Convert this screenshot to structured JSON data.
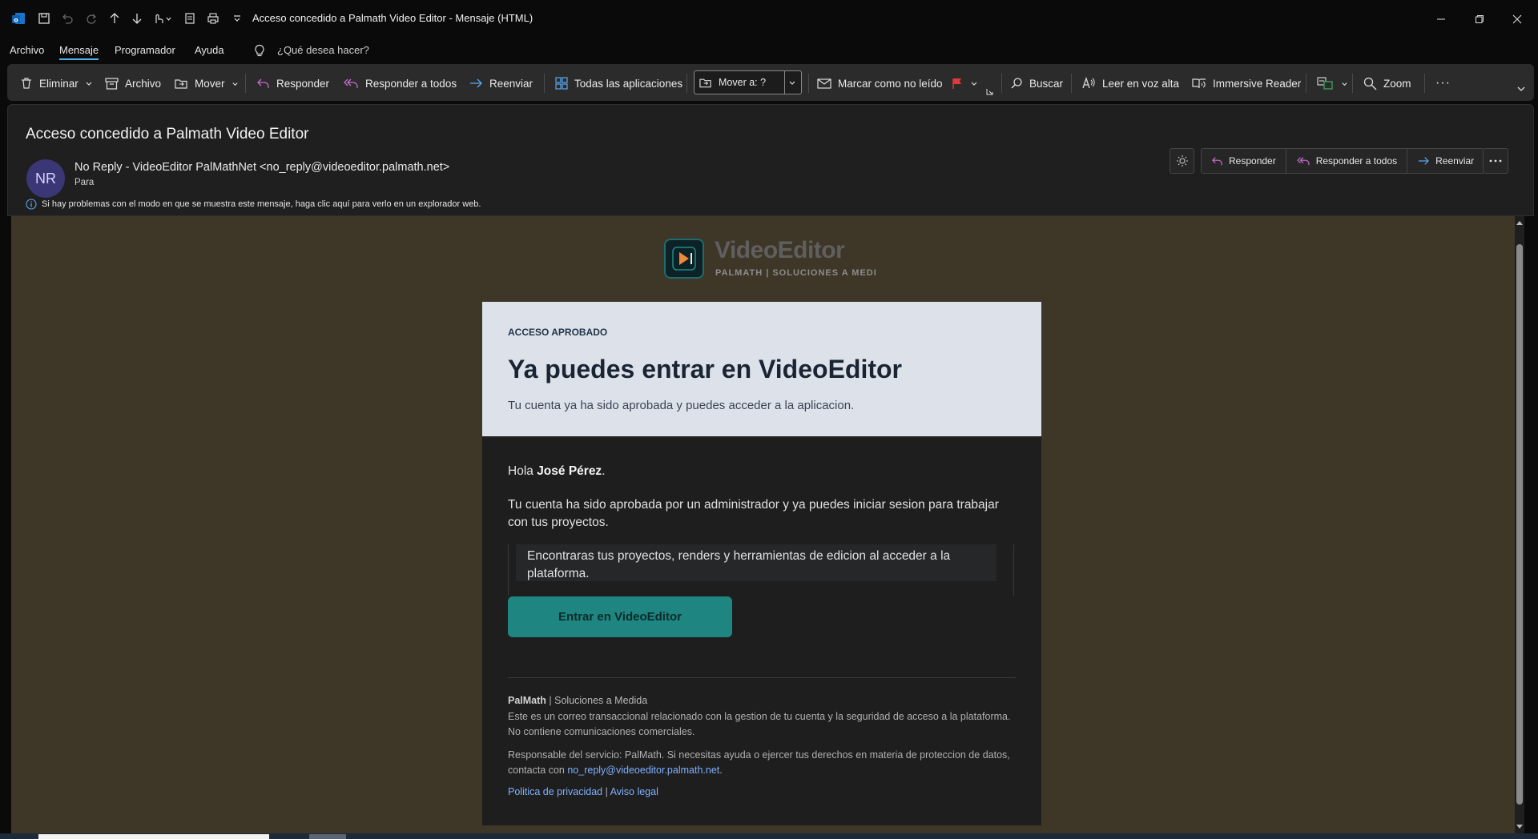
{
  "window": {
    "title": "Acceso concedido a Palmath Video Editor  -  Mensaje (HTML)"
  },
  "menu": {
    "items": [
      "Archivo",
      "Mensaje",
      "Programador",
      "Ayuda"
    ],
    "tell_me": "¿Qué desea hacer?"
  },
  "ribbon": {
    "delete": "Eliminar",
    "archive": "Archivo",
    "move": "Mover",
    "reply": "Responder",
    "reply_all": "Responder a todos",
    "forward": "Reenviar",
    "all_apps": "Todas las aplicaciones",
    "move_to": "Mover a: ?",
    "mark_unread": "Marcar como no leído",
    "search": "Buscar",
    "read_aloud": "Leer en voz alta",
    "immersive": "Immersive Reader",
    "zoom": "Zoom",
    "more": "···"
  },
  "message": {
    "subject": "Acceso concedido a Palmath Video Editor",
    "avatar_initials": "NR",
    "sender": "No Reply - VideoEditor PalMathNet <no_reply@videoeditor.palmath.net>",
    "to_label": "Para",
    "info": "Si hay problemas con el modo en que se muestra este mensaje, haga clic aquí para verlo en un explorador web.",
    "actions": {
      "reply": "Responder",
      "reply_all": "Responder a todos",
      "forward": "Reenviar"
    }
  },
  "email": {
    "logo_title": "VideoEditor",
    "logo_sub": "PALMATH | SOLUCIONES A MEDI",
    "eyebrow": "ACCESO APROBADO",
    "headline": "Ya puedes entrar en VideoEditor",
    "lead": "Tu cuenta ya ha sido aprobada y puedes acceder a la aplicacion.",
    "greeting_prefix": "Hola ",
    "greeting_name": "José Pérez",
    "greeting_suffix": ".",
    "paragraph": "Tu cuenta ha sido aprobada por un administrador y ya puedes iniciar sesion para trabajar con tus proyectos.",
    "callout": "Encontraras tus proyectos, renders y herramientas de edicion al acceder a la plataforma.",
    "cta": "Entrar en VideoEditor",
    "footer_brand": "PalMath",
    "footer_tagline": " | Soluciones a Medida",
    "footer_note": "Este es un correo transaccional relacionado con la gestion de tu cuenta y la seguridad de acceso a la plataforma. No contiene comunicaciones comerciales.",
    "footer_resp": "Responsable del servicio: PalMath. Si necesitas ayuda o ejercer tus derechos en materia de proteccion de datos, contacta con ",
    "footer_email": "no_reply@videoeditor.palmath.net",
    "footer_resp_end": ".",
    "privacy": "Politica de privacidad",
    "legal_sep": " | ",
    "legal": "Aviso legal"
  },
  "colors": {
    "accent": "#4fb3e8",
    "cta": "#1e8580",
    "body_bg": "#3e3627"
  }
}
